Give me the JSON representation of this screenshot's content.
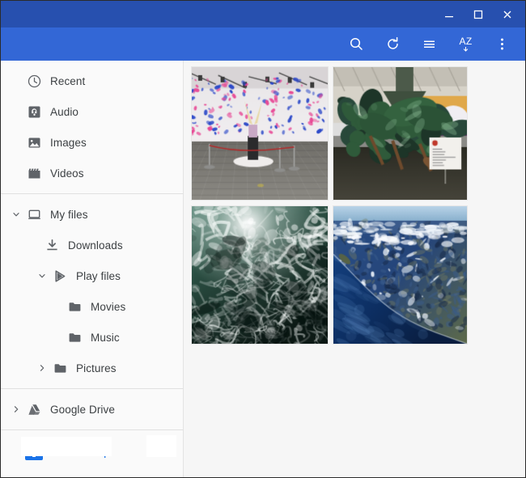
{
  "window": {
    "controls": [
      {
        "name": "minimize-button",
        "label": "–"
      },
      {
        "name": "maximize-button",
        "label": "□"
      },
      {
        "name": "close-button",
        "label": "✕"
      }
    ],
    "titlebar_color": "#2750af",
    "toolbar_color": "#3367d6"
  },
  "toolbar": {
    "buttons": [
      {
        "name": "search-icon",
        "label": "Search"
      },
      {
        "name": "refresh-icon",
        "label": "Refresh"
      },
      {
        "name": "list-view-icon",
        "label": "List view"
      },
      {
        "name": "sort-az-icon",
        "label": "AZ"
      },
      {
        "name": "more-options-icon",
        "label": "More options"
      }
    ]
  },
  "sidebar": {
    "accent_color": "#1a73e8",
    "groups": [
      {
        "items": [
          {
            "label": "Recent",
            "icon": "clock-icon",
            "level": "top",
            "chevron": "none"
          },
          {
            "label": "Audio",
            "icon": "audio-icon",
            "level": "top",
            "chevron": "none"
          },
          {
            "label": "Images",
            "icon": "image-icon",
            "level": "top",
            "chevron": "none"
          },
          {
            "label": "Videos",
            "icon": "video-icon",
            "level": "top",
            "chevron": "none"
          }
        ]
      },
      {
        "items": [
          {
            "label": "My files",
            "icon": "computer-icon",
            "level": "1",
            "chevron": "down"
          },
          {
            "label": "Downloads",
            "icon": "download-icon",
            "level": "3",
            "chevron": "none"
          },
          {
            "label": "Play files",
            "icon": "play-icon",
            "level": "2",
            "chevron": "down"
          },
          {
            "label": "Movies",
            "icon": "folder-icon",
            "level": "4",
            "chevron": "none"
          },
          {
            "label": "Music",
            "icon": "folder-icon",
            "level": "4",
            "chevron": "none"
          },
          {
            "label": "Pictures",
            "icon": "folder-icon",
            "level": "3",
            "chevron": "right"
          }
        ]
      },
      {
        "items": [
          {
            "label": "Google Drive",
            "icon": "google-drive-icon",
            "level": "1",
            "chevron": "right"
          }
        ]
      },
      {
        "items": [
          {
            "label": "Archive.zip",
            "icon": "zip-file-icon",
            "level": "1",
            "chevron": "none",
            "selected": true,
            "action": "eject-icon"
          }
        ]
      }
    ]
  },
  "main": {
    "view": "thumbnail-grid",
    "thumbnails": [
      {
        "name": "thumbnail-gallery-installation",
        "alt": "Gallery installation with pink and blue butterflies on white walls"
      },
      {
        "name": "thumbnail-bronze-sculpture",
        "alt": "Green bronze sculpture of figures in a museum hall"
      },
      {
        "name": "thumbnail-sea-foam",
        "alt": "Aerial view of white sea foam on dark green ocean water"
      },
      {
        "name": "thumbnail-aerial-coastline",
        "alt": "Satellite view of a coastline with deep blue sea and land"
      }
    ]
  }
}
